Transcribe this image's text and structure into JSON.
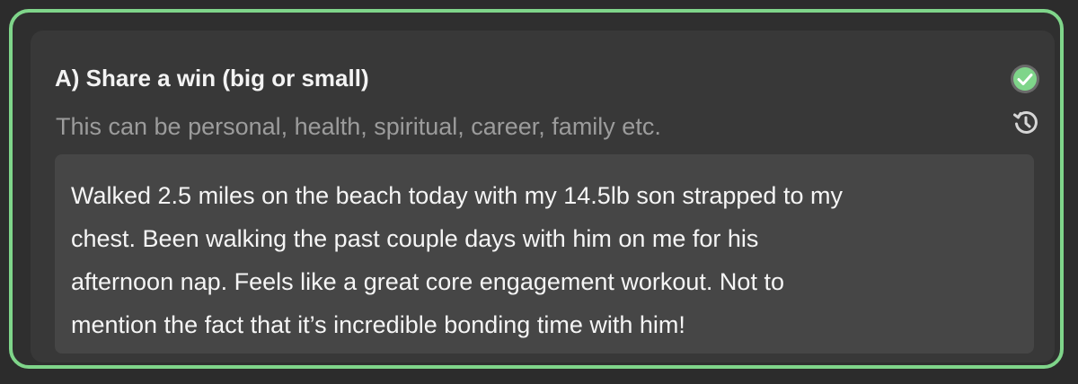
{
  "prompt": {
    "title": "A) Share a win (big or small)",
    "subtitle": "This can be personal, health, spiritual, career, family etc."
  },
  "answer": {
    "text": "Walked 2.5 miles on the beach today with my 14.5lb son strapped to my\nchest. Been walking the past couple days with him on me for his\nafternoon nap. Feels like a great core engagement workout. Not to\nmention the fact that it’s incredible bonding time with him!"
  },
  "icons": {
    "status": "check-circle-icon",
    "history": "history-icon"
  },
  "colors": {
    "accent_border": "#7fd58a",
    "check_fill": "#7fd58a"
  }
}
